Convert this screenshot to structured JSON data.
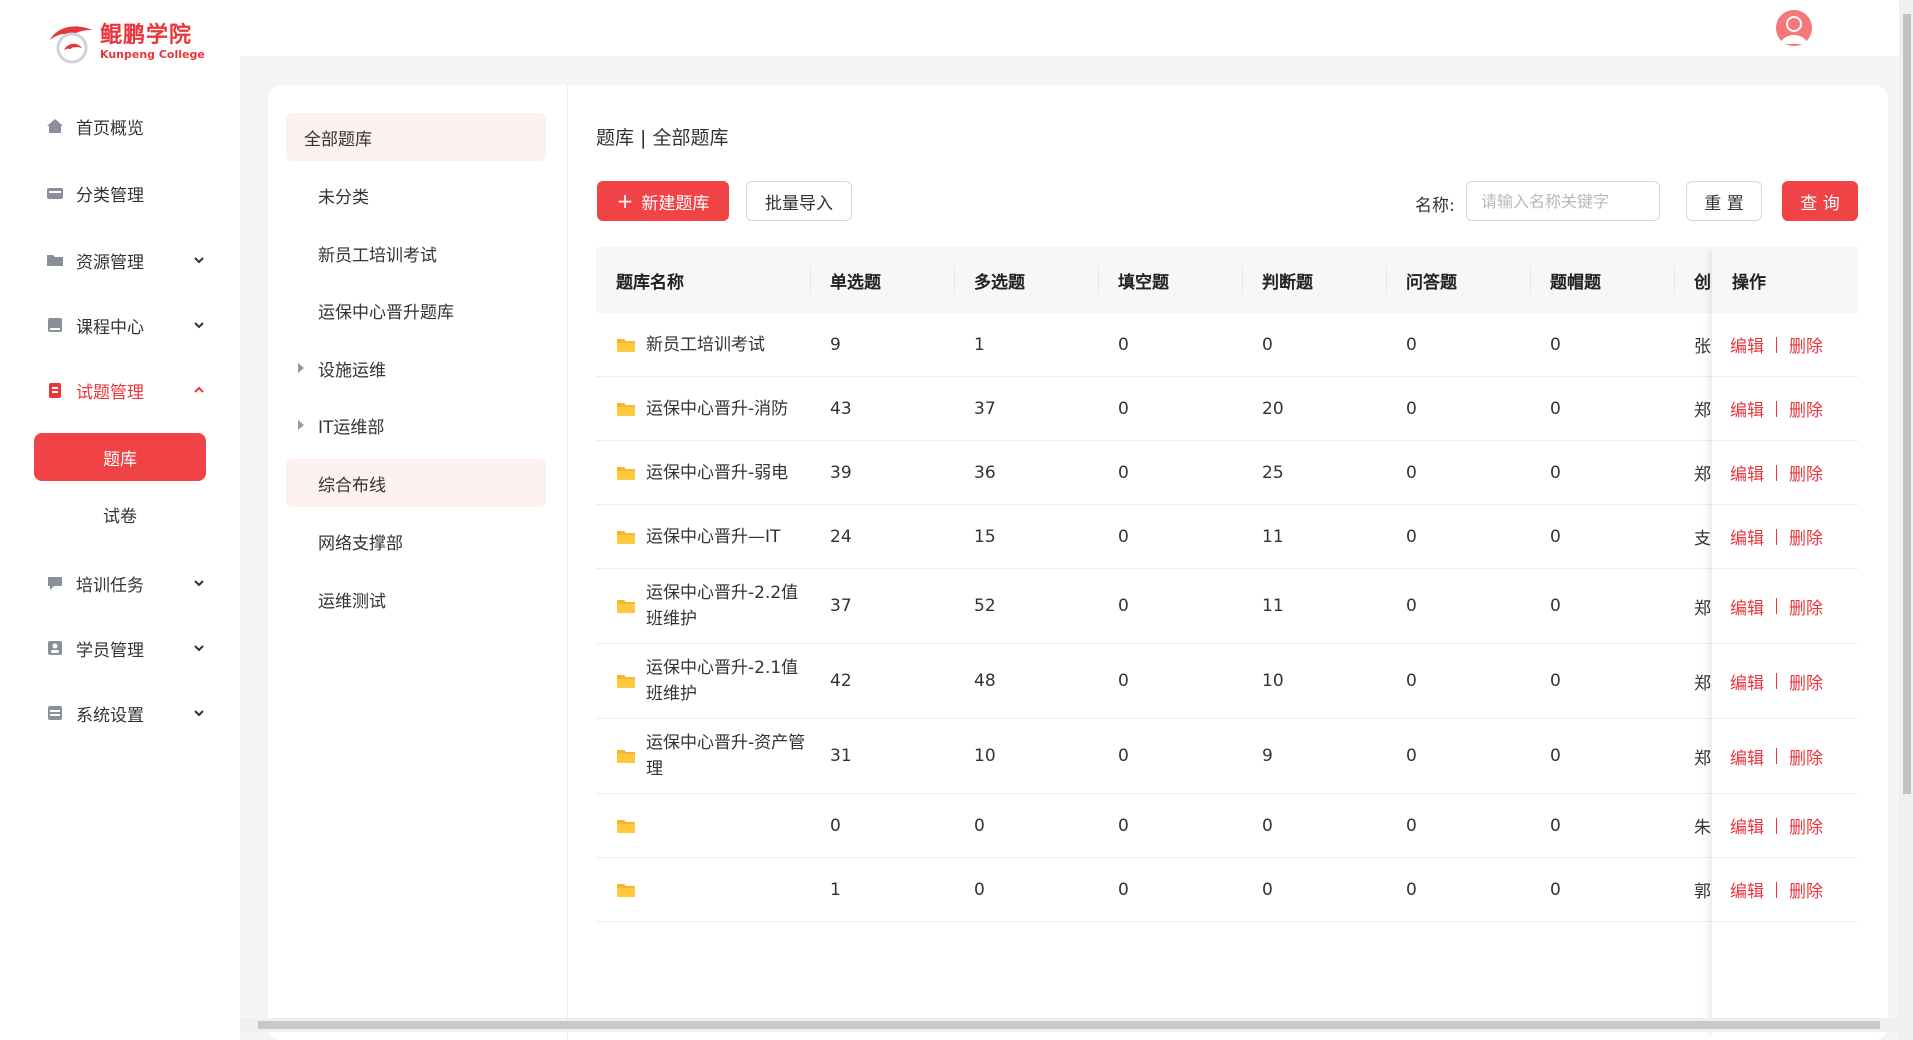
{
  "app": {
    "logo_cn": "鲲鹏学院",
    "logo_en": "Kunpeng College",
    "brand_color": "#e9363c"
  },
  "sidebar": {
    "items": [
      {
        "label": "首页概览",
        "icon": "home-icon",
        "has_chevron": false
      },
      {
        "label": "分类管理",
        "icon": "category-icon",
        "has_chevron": false
      },
      {
        "label": "资源管理",
        "icon": "folder-icon",
        "has_chevron": true
      },
      {
        "label": "课程中心",
        "icon": "book-icon",
        "has_chevron": true
      },
      {
        "label": "试题管理",
        "icon": "clipboard-icon",
        "has_chevron": true,
        "expanded": true,
        "active": true
      },
      {
        "label": "培训任务",
        "icon": "chat-icon",
        "has_chevron": true
      },
      {
        "label": "学员管理",
        "icon": "user-card-icon",
        "has_chevron": true
      },
      {
        "label": "系统设置",
        "icon": "settings-icon",
        "has_chevron": true
      }
    ],
    "subitems": [
      {
        "label": "题库",
        "active": true
      },
      {
        "label": "试卷",
        "active": false
      }
    ]
  },
  "tree": {
    "items": [
      {
        "label": "全部题库",
        "selected": true,
        "expandable": false
      },
      {
        "label": "未分类",
        "selected": false,
        "expandable": false
      },
      {
        "label": "新员工培训考试",
        "selected": false,
        "expandable": false
      },
      {
        "label": "运保中心晋升题库",
        "selected": false,
        "expandable": false
      },
      {
        "label": "设施运维",
        "selected": false,
        "expandable": true
      },
      {
        "label": "IT运维部",
        "selected": false,
        "expandable": true
      },
      {
        "label": "综合布线",
        "selected": true,
        "expandable": false
      },
      {
        "label": "网络支撑部",
        "selected": false,
        "expandable": false
      },
      {
        "label": "运维测试",
        "selected": false,
        "expandable": false
      }
    ]
  },
  "main": {
    "breadcrumb": "题库 | 全部题库",
    "new_button": "新建题库",
    "import_button": "批量导入",
    "search_label": "名称:",
    "search_placeholder": "请输入名称关键字",
    "search_value": "",
    "reset_button": "重 置",
    "query_button": "查 询"
  },
  "table": {
    "columns": [
      "题库名称",
      "单选题",
      "多选题",
      "填空题",
      "判断题",
      "问答题",
      "题帽题",
      "创",
      "操作"
    ],
    "action_edit": "编辑",
    "action_delete": "删除",
    "rows": [
      {
        "name": "新员工培训考试",
        "single": "9",
        "multi": "1",
        "fill": "0",
        "judge": "0",
        "qa": "0",
        "cap": "0",
        "creator": "张"
      },
      {
        "name": "运保中心晋升-消防",
        "single": "43",
        "multi": "37",
        "fill": "0",
        "judge": "20",
        "qa": "0",
        "cap": "0",
        "creator": "郑"
      },
      {
        "name": "运保中心晋升-弱电",
        "single": "39",
        "multi": "36",
        "fill": "0",
        "judge": "25",
        "qa": "0",
        "cap": "0",
        "creator": "郑"
      },
      {
        "name": "运保中心晋升—IT",
        "single": "24",
        "multi": "15",
        "fill": "0",
        "judge": "11",
        "qa": "0",
        "cap": "0",
        "creator": "支"
      },
      {
        "name": "运保中心晋升-2.2值班维护",
        "single": "37",
        "multi": "52",
        "fill": "0",
        "judge": "11",
        "qa": "0",
        "cap": "0",
        "creator": "郑"
      },
      {
        "name": "运保中心晋升-2.1值班维护",
        "single": "42",
        "multi": "48",
        "fill": "0",
        "judge": "10",
        "qa": "0",
        "cap": "0",
        "creator": "郑"
      },
      {
        "name": "运保中心晋升-资产管理",
        "single": "31",
        "multi": "10",
        "fill": "0",
        "judge": "9",
        "qa": "0",
        "cap": "0",
        "creator": "郑"
      },
      {
        "name": "",
        "single": "0",
        "multi": "0",
        "fill": "0",
        "judge": "0",
        "qa": "0",
        "cap": "0",
        "creator": "朱"
      },
      {
        "name": "",
        "single": "1",
        "multi": "0",
        "fill": "0",
        "judge": "0",
        "qa": "0",
        "cap": "0",
        "creator": "郭"
      }
    ]
  }
}
